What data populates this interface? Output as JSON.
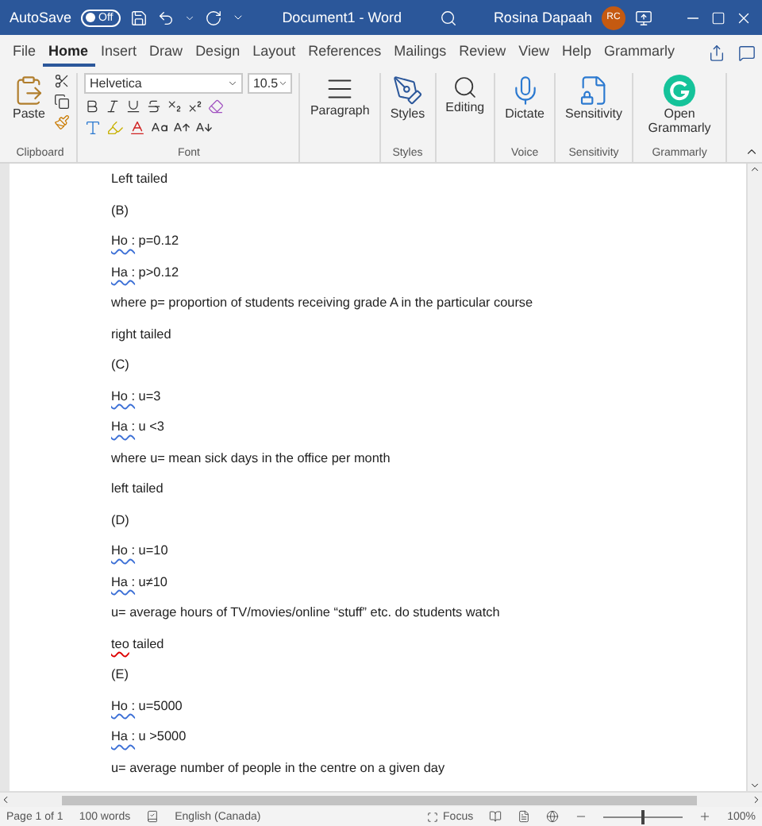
{
  "title_bar": {
    "autosave": {
      "label": "AutoSave",
      "state_text": "Off",
      "on": false
    },
    "document_title": "Document1  -  Word",
    "user": {
      "name": "Rosina Dapaah",
      "initials": "RC"
    }
  },
  "tabs": [
    {
      "label": "File",
      "selected": false
    },
    {
      "label": "Home",
      "selected": true
    },
    {
      "label": "Insert",
      "selected": false
    },
    {
      "label": "Draw",
      "selected": false
    },
    {
      "label": "Design",
      "selected": false
    },
    {
      "label": "Layout",
      "selected": false
    },
    {
      "label": "References",
      "selected": false
    },
    {
      "label": "Mailings",
      "selected": false
    },
    {
      "label": "Review",
      "selected": false
    },
    {
      "label": "View",
      "selected": false
    },
    {
      "label": "Help",
      "selected": false
    },
    {
      "label": "Grammarly",
      "selected": false
    }
  ],
  "ribbon": {
    "clipboard": {
      "paste": "Paste",
      "group": "Clipboard"
    },
    "font": {
      "name": "Helvetica",
      "size": "10.5",
      "group": "Font"
    },
    "paragraph": "Paragraph",
    "styles": {
      "button": "Styles",
      "group": "Styles"
    },
    "editing": "Editing",
    "voice": {
      "button": "Dictate",
      "group": "Voice"
    },
    "sensitivity": {
      "button": "Sensitivity",
      "group": "Sensitivity"
    },
    "grammarly": {
      "button": "Open Grammarly",
      "group": "Grammarly"
    }
  },
  "document": {
    "lines": [
      {
        "text": "Left tailed"
      },
      {
        "text": "(B)"
      },
      {
        "marked": "Ho :",
        "kind": "grammar",
        "text": " p=0.12"
      },
      {
        "marked": "Ha :",
        "kind": "grammar",
        "text": " p>0.12"
      },
      {
        "text": "where p= proportion of students receiving grade A in the particular course"
      },
      {
        "text": "right tailed"
      },
      {
        "text": "(C)"
      },
      {
        "marked": "Ho :",
        "kind": "grammar",
        "text": " u=3"
      },
      {
        "marked": "Ha :",
        "kind": "grammar",
        "text": " u <3"
      },
      {
        "text": "where u= mean sick days in the office per month"
      },
      {
        "text": "left tailed"
      },
      {
        "text": "(D)"
      },
      {
        "marked": "Ho :",
        "kind": "grammar",
        "text": " u=10"
      },
      {
        "marked": "Ha :",
        "kind": "grammar",
        "text": " u≠10"
      },
      {
        "text": "u= average hours of TV/movies/online “stuff” etc. do students watch"
      },
      {
        "marked": "teo",
        "kind": "spelling",
        "text": " tailed"
      },
      {
        "text": "(E)"
      },
      {
        "marked": "Ho :",
        "kind": "grammar",
        "text": " u=5000"
      },
      {
        "marked": "Ha :",
        "kind": "grammar",
        "text": " u >5000"
      },
      {
        "text": "u= average number of people in the centre on a given day"
      }
    ]
  },
  "status_bar": {
    "page": "Page 1 of 1",
    "words": "100 words",
    "language": "English (Canada)",
    "focus": "Focus",
    "zoom": {
      "level": 0.5,
      "reading": "100%"
    }
  }
}
